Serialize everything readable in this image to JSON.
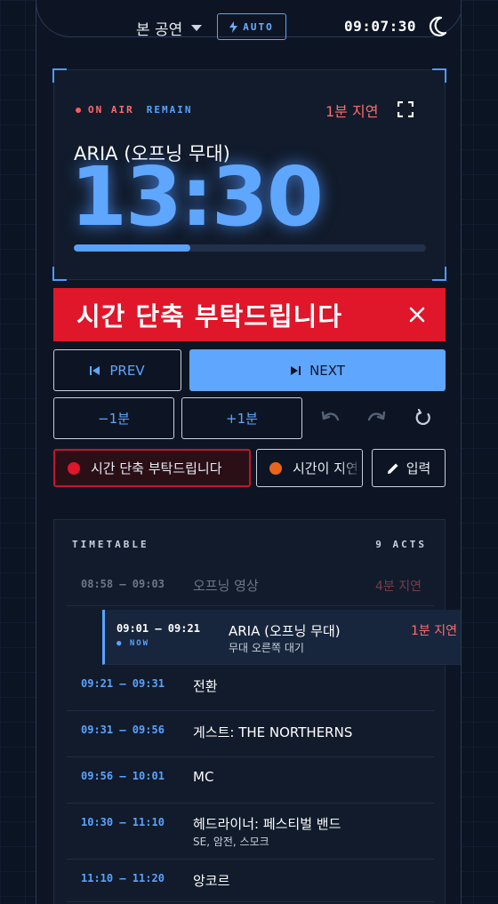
{
  "header": {
    "show_label": "본 공연",
    "auto_label": "AUTO",
    "clock": "09:07:30"
  },
  "timer": {
    "on_air": "ON AIR",
    "remain": "REMAIN",
    "delay": "1분 지연",
    "act_title": "ARIA (오프닝 무대)",
    "time": "13:30",
    "progress_fraction": 0.33
  },
  "alert": {
    "text": "시간 단축 부탁드립니다"
  },
  "controls": {
    "prev": "PREV",
    "next": "NEXT",
    "minus": "−1분",
    "plus": "+1분"
  },
  "presets": [
    {
      "label": "시간 단축 부탁드립니다",
      "color": "#e0162a"
    },
    {
      "label": "시간이 지연",
      "color": "#e8661a"
    }
  ],
  "input_label": "입력",
  "timetable": {
    "title": "TIMETABLE",
    "count": "9 ACTS",
    "rows": [
      {
        "time": "08:58 – 09:03",
        "title": "오프닝 영상",
        "sub": "",
        "delay": "4분 지연",
        "state": "past"
      },
      {
        "time": "09:01 – 09:21",
        "title": "ARIA (오프닝 무대)",
        "sub": "무대 오른쪽 대기",
        "delay": "1분 지연",
        "state": "current",
        "now": "NOW"
      },
      {
        "time": "09:21 – 09:31",
        "title": "전환",
        "sub": "",
        "delay": "",
        "state": "upcoming"
      },
      {
        "time": "09:31 – 09:56",
        "title": "게스트: THE NORTHERNS",
        "sub": "",
        "delay": "",
        "state": "upcoming"
      },
      {
        "time": "09:56 – 10:01",
        "title": "MC",
        "sub": "",
        "delay": "",
        "state": "upcoming"
      },
      {
        "time": "10:30 – 11:10",
        "title": "헤드라이너: 페스티벌 밴드",
        "sub": "SE, 암전, 스모크",
        "delay": "",
        "state": "upcoming"
      },
      {
        "time": "11:10 – 11:20",
        "title": "앙코르",
        "sub": "",
        "delay": "",
        "state": "upcoming"
      }
    ]
  }
}
